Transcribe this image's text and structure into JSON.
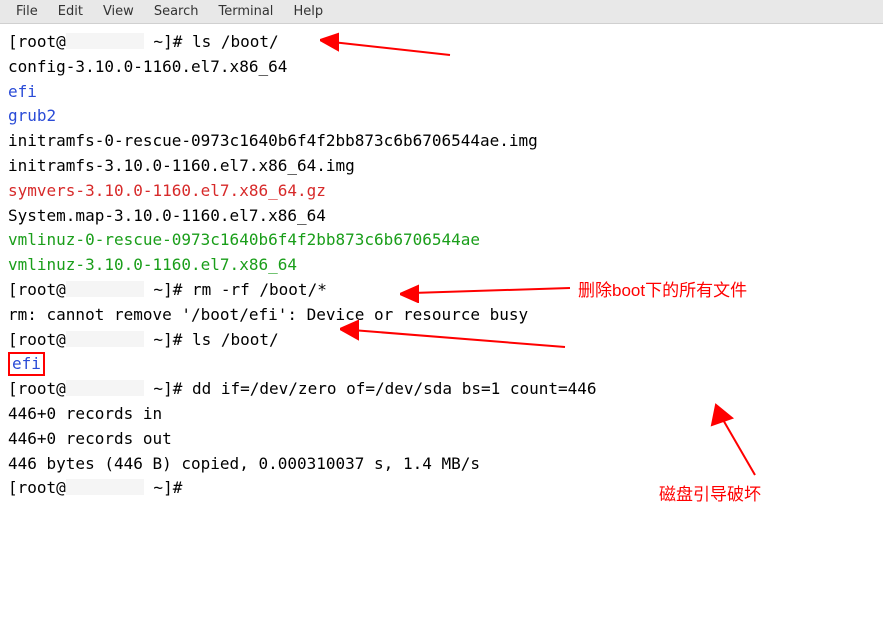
{
  "menubar": {
    "items": [
      "File",
      "Edit",
      "View",
      "Search",
      "Terminal",
      "Help"
    ]
  },
  "terminal": {
    "lines": [
      {
        "prompt_prefix": "[root@",
        "prompt_suffix": " ~]# ",
        "cmd": "ls /boot/"
      },
      {
        "text": "config-3.10.0-1160.el7.x86_64"
      },
      {
        "text": "efi",
        "class": "blue"
      },
      {
        "text": "grub2",
        "class": "blue"
      },
      {
        "text": "initramfs-0-rescue-0973c1640b6f4f2bb873c6b6706544ae.img"
      },
      {
        "text": "initramfs-3.10.0-1160.el7.x86_64.img"
      },
      {
        "text": "symvers-3.10.0-1160.el7.x86_64.gz",
        "class": "red"
      },
      {
        "text": "System.map-3.10.0-1160.el7.x86_64"
      },
      {
        "text": "vmlinuz-0-rescue-0973c1640b6f4f2bb873c6b6706544ae",
        "class": "green"
      },
      {
        "text": "vmlinuz-3.10.0-1160.el7.x86_64",
        "class": "green"
      },
      {
        "prompt_prefix": "[root@",
        "prompt_suffix": " ~]# ",
        "cmd": "rm -rf /boot/*"
      },
      {
        "text": "rm: cannot remove '/boot/efi': Device or resource busy"
      },
      {
        "prompt_prefix": "[root@",
        "prompt_suffix": " ~]# ",
        "cmd": "ls /boot/"
      },
      {
        "text": "efi",
        "class": "blue boxed"
      },
      {
        "prompt_prefix": "[root@",
        "prompt_suffix": " ~]# ",
        "cmd": "dd if=/dev/zero of=/dev/sda bs=1 count=446"
      },
      {
        "text": "446+0 records in"
      },
      {
        "text": "446+0 records out"
      },
      {
        "text": "446 bytes (446 B) copied, 0.000310037 s, 1.4 MB/s"
      },
      {
        "prompt_prefix": "[root@",
        "prompt_suffix": " ~]# ",
        "cmd": ""
      }
    ]
  },
  "annotations": {
    "a1": "删除boot下的所有文件",
    "a2": "磁盘引导破坏"
  }
}
